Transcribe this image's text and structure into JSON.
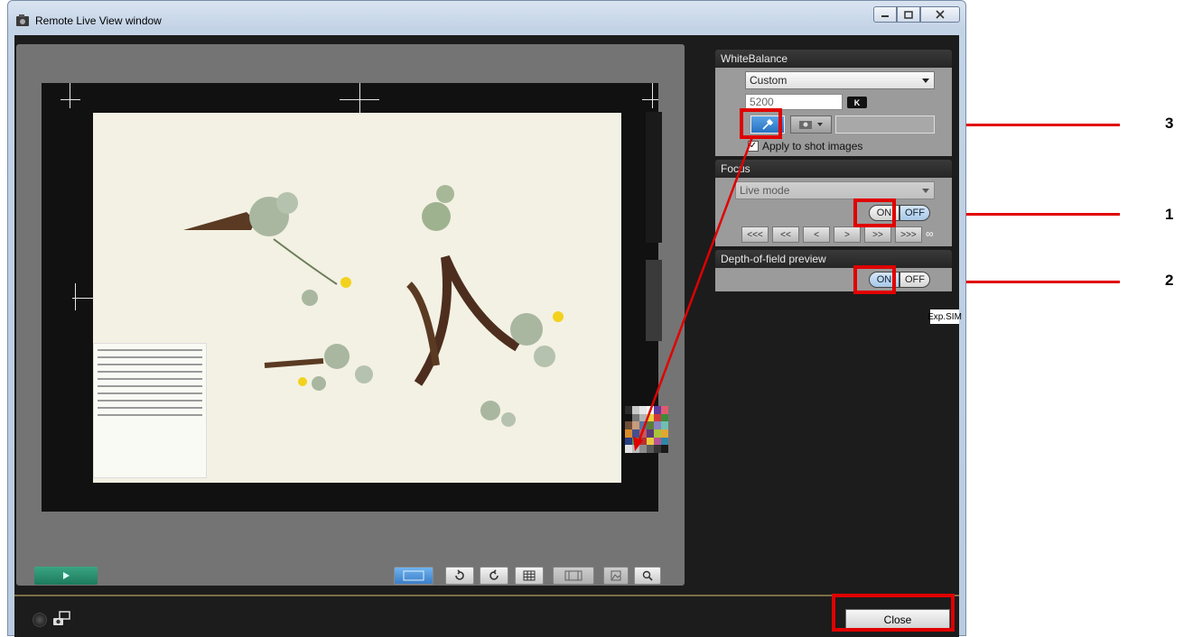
{
  "window": {
    "title": "Remote Live View window"
  },
  "white_balance": {
    "header": "WhiteBalance",
    "mode": "Custom",
    "kelvin_value": "5200",
    "kelvin_unit": "K",
    "apply_label": "Apply to shot images",
    "apply_checked": true
  },
  "focus": {
    "header": "Focus",
    "mode": "Live mode",
    "on_label": "ON",
    "off_label": "OFF",
    "buttons": [
      "<<<",
      "<<",
      "<",
      ">",
      ">>",
      ">>>"
    ],
    "infinity": "∞"
  },
  "dof": {
    "header": "Depth-of-field preview",
    "on_label": "ON",
    "off_label": "OFF"
  },
  "exp_sim": "Exp.SIM",
  "close_label": "Close",
  "callouts": [
    "3",
    "1",
    "2"
  ],
  "colors": {
    "annotation_red": "#e00000",
    "panel_bg": "#1c1c1c",
    "preview_bg": "#747474",
    "play_green": "#2a8f6f"
  }
}
